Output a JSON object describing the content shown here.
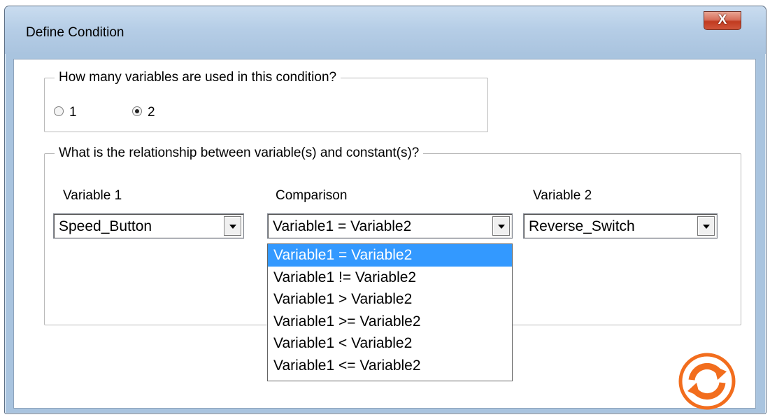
{
  "window": {
    "title": "Define Condition",
    "close_glyph": "X"
  },
  "variables_group": {
    "legend": "How many variables are used in this condition?",
    "options": [
      {
        "label": "1",
        "selected": false
      },
      {
        "label": "2",
        "selected": true
      }
    ]
  },
  "relationship_group": {
    "legend": "What is the relationship between variable(s) and constant(s)?",
    "variable1": {
      "label": "Variable 1",
      "value": "Speed_Button"
    },
    "comparison": {
      "label": "Comparison",
      "value": "Variable1 = Variable2"
    },
    "variable2": {
      "label": "Variable 2",
      "value": "Reverse_Switch"
    }
  },
  "comparison_options": [
    "Variable1 = Variable2",
    "Variable1 != Variable2",
    "Variable1 > Variable2",
    "Variable1 >= Variable2",
    "Variable1 < Variable2",
    "Variable1 <= Variable2"
  ],
  "selected_option_index": 0,
  "colors": {
    "selection": "#3399ff",
    "refresh_icon": "#f26d1d"
  },
  "icons": {
    "refresh": "refresh-icon",
    "close": "close-icon"
  }
}
